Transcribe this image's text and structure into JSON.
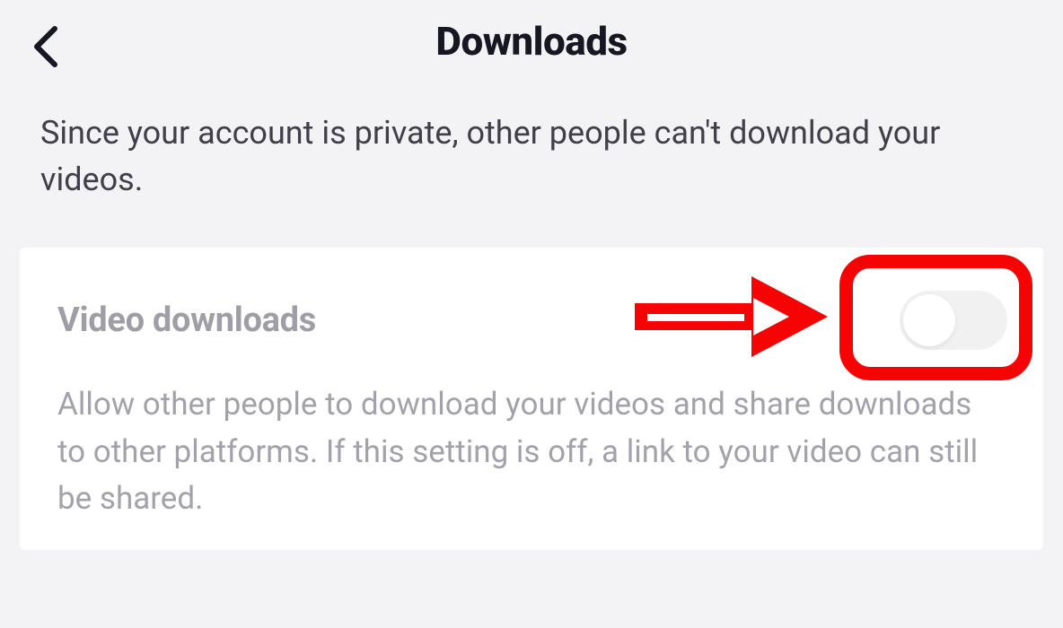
{
  "header": {
    "title": "Downloads"
  },
  "info_text": "Since your account is private, other people can't download your videos.",
  "setting": {
    "title": "Video downloads",
    "description": "Allow other people to download your videos and share downloads to other platforms. If this setting is off, a link to your video can still be shared.",
    "enabled": false
  }
}
